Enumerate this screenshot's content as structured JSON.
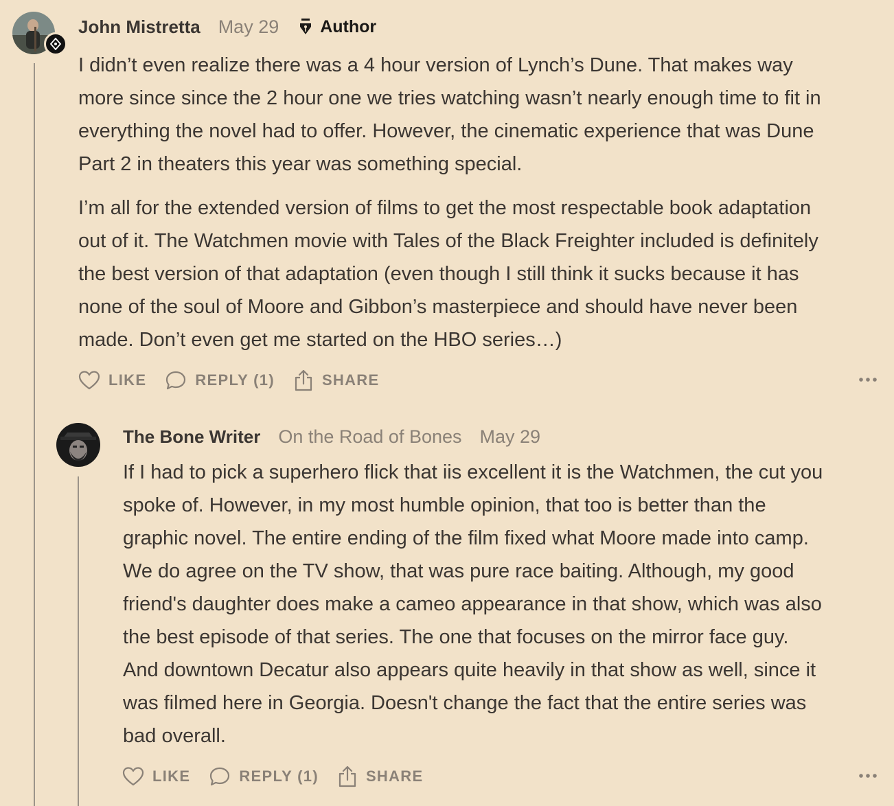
{
  "comments": [
    {
      "author": "John Mistretta",
      "date": "May 29",
      "role_badge": "Author",
      "paragraphs": [
        [
          "I didn’t even realize there was a 4 hour version of Lynch’s Dune. That makes way",
          "more since since the 2 hour one we tries watching wasn’t nearly enough time to fit in",
          "everything the novel had to offer. However, the cinematic experience that was Dune",
          "Part 2 in theaters this year was something special."
        ],
        [
          "I’m all for the extended version of films to get the most respectable book adaptation",
          "out of it. The Watchmen movie with Tales of the Black Freighter included is definitely",
          "the best version of that adaptation (even though I still think it sucks because it has",
          "none of the soul of Moore and Gibbon’s masterpiece and should have never been",
          "made. Don’t even get me started on the HBO series…)"
        ]
      ],
      "actions": {
        "like": "LIKE",
        "reply": "REPLY (1)",
        "share": "SHARE"
      }
    },
    {
      "author": "The Bone Writer",
      "publication": "On the Road of Bones",
      "date": "May 29",
      "paragraphs": [
        [
          "If I had to pick a superhero flick that iis excellent it is the Watchmen, the cut you",
          "spoke of. However, in my most humble opinion, that too is better than the",
          "graphic novel. The entire ending of the film fixed what Moore made into camp.",
          "We do agree on the TV show, that was pure race baiting. Although, my good",
          "friend's daughter does make a cameo appearance in that show, which was also",
          "the best episode of that series. The one that focuses on the mirror face guy.",
          "And downtown Decatur also appears quite heavily in that show as well, since it",
          "was filmed here in Georgia. Doesn't change the fact that the entire series was",
          "bad overall."
        ]
      ],
      "actions": {
        "like": "LIKE",
        "reply": "REPLY (1)",
        "share": "SHARE"
      }
    }
  ],
  "icons": {
    "like": "heart-icon",
    "reply": "speech-bubble-icon",
    "share": "share-upload-icon",
    "more": "more-dots-icon",
    "author_badge": "fountain-pen-nib-icon"
  },
  "colors": {
    "background": "#f2e2c9",
    "text": "#3b3632",
    "muted": "#8a8177",
    "thread_line": "#9b9389"
  }
}
